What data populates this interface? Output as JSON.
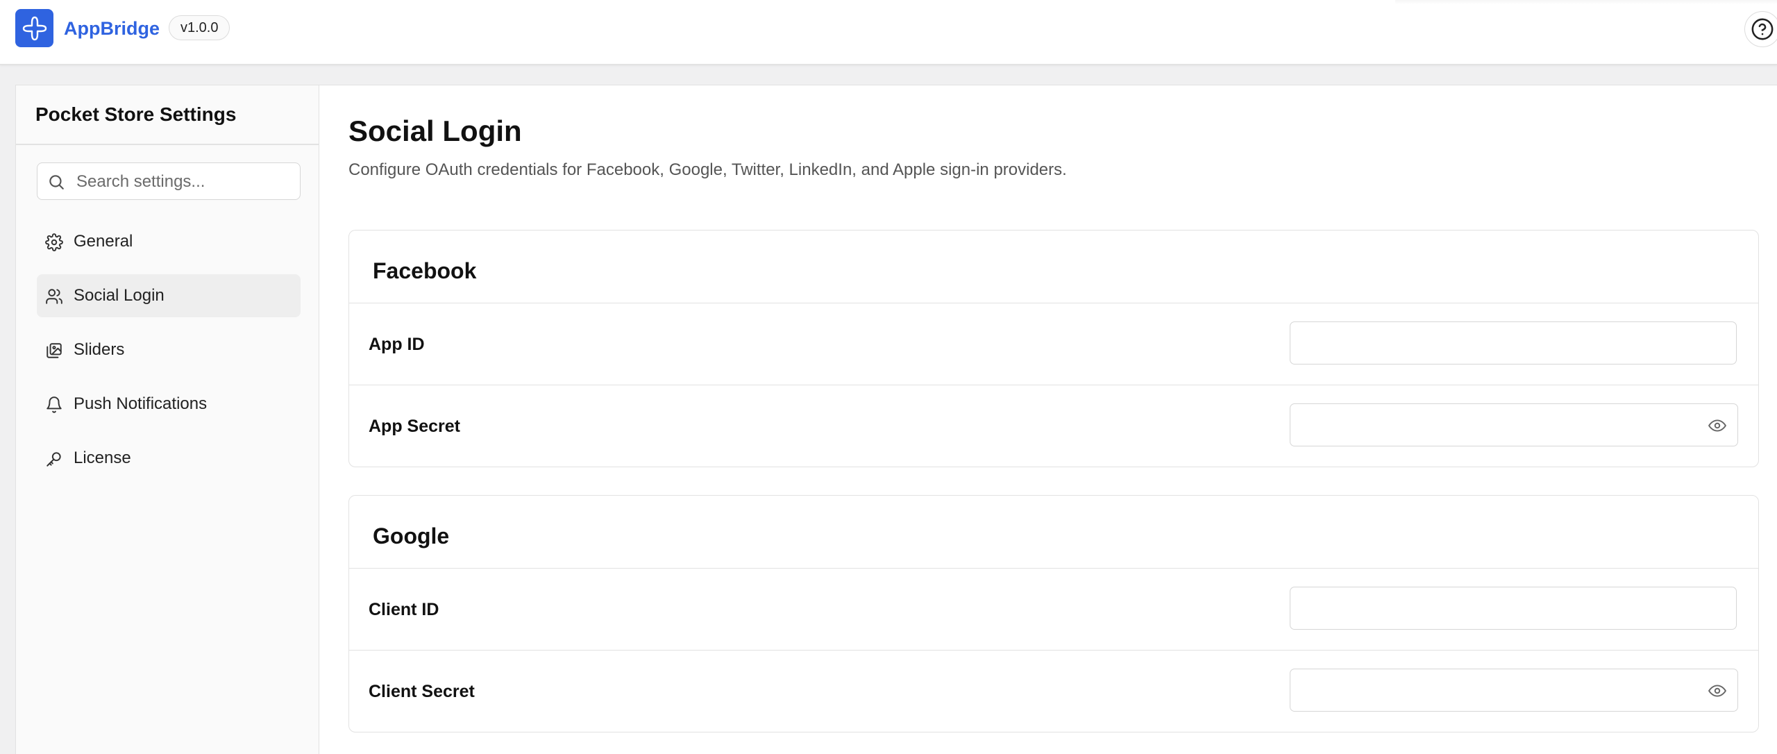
{
  "header": {
    "brand": "AppBridge",
    "version": "v1.0.0",
    "brand_color": "#2f63e0"
  },
  "sidebar": {
    "title": "Pocket Store Settings",
    "search_placeholder": "Search settings...",
    "items": [
      {
        "label": "General",
        "icon": "gear-icon",
        "active": false
      },
      {
        "label": "Social Login",
        "icon": "users-icon",
        "active": true
      },
      {
        "label": "Sliders",
        "icon": "images-icon",
        "active": false
      },
      {
        "label": "Push Notifications",
        "icon": "bell-icon",
        "active": false
      },
      {
        "label": "License",
        "icon": "key-icon",
        "active": false
      }
    ]
  },
  "main": {
    "title": "Social Login",
    "subtitle": "Configure OAuth credentials for Facebook, Google, Twitter, LinkedIn, and Apple sign-in providers.",
    "sections": [
      {
        "title": "Facebook",
        "fields": [
          {
            "label": "App ID",
            "value": "",
            "secret": false
          },
          {
            "label": "App Secret",
            "value": "",
            "secret": true
          }
        ]
      },
      {
        "title": "Google",
        "fields": [
          {
            "label": "Client ID",
            "value": "",
            "secret": false
          },
          {
            "label": "Client Secret",
            "value": "",
            "secret": true
          }
        ]
      }
    ]
  }
}
